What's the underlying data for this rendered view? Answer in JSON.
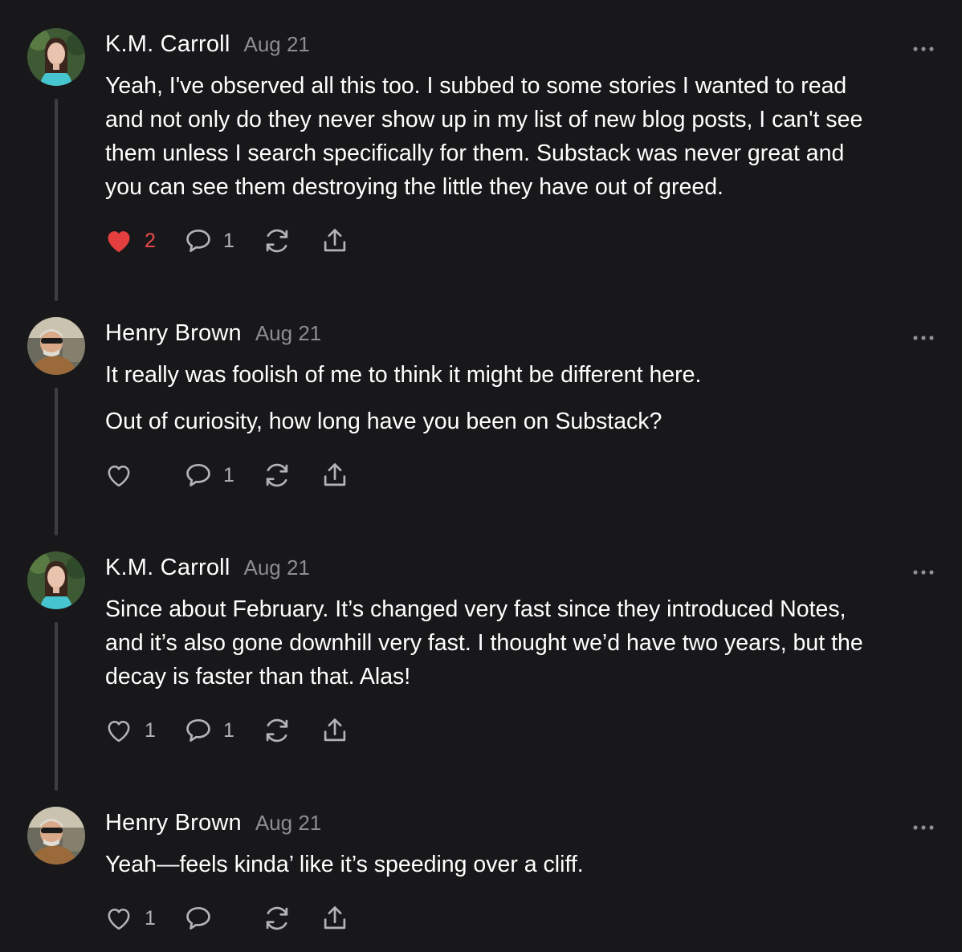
{
  "accent": "#e53e3e",
  "comments": [
    {
      "author": "K.M. Carroll",
      "date": "Aug 21",
      "avatar": "woman-portrait",
      "paragraphs": [
        "Yeah, I've observed all this too. I subbed to some stories I wanted to read\nand not only do they never show up in my list of new blog posts, I can't see\nthem unless I search specifically for them. Substack was never great and\nyou can see them destroying the little they have out of greed."
      ],
      "likes": "2",
      "liked": true,
      "replies": "1"
    },
    {
      "author": "Henry Brown",
      "date": "Aug 21",
      "avatar": "man-sunglasses-portrait",
      "paragraphs": [
        "It really was foolish of me to think it might be different here.",
        "Out of curiosity, how long have you been on Substack?"
      ],
      "likes": "",
      "liked": false,
      "replies": "1"
    },
    {
      "author": "K.M. Carroll",
      "date": "Aug 21",
      "avatar": "woman-portrait",
      "paragraphs": [
        "Since about February. It’s changed very fast since they introduced Notes,\nand it’s also gone downhill very fast. I thought we’d have two years, but the\ndecay is faster than that. Alas!"
      ],
      "likes": "1",
      "liked": false,
      "replies": "1"
    },
    {
      "author": "Henry Brown",
      "date": "Aug 21",
      "avatar": "man-sunglasses-portrait",
      "paragraphs": [
        "Yeah—feels kinda’ like it’s speeding over a cliff."
      ],
      "likes": "1",
      "liked": false,
      "replies": ""
    }
  ],
  "icons": {
    "like": "heart-icon",
    "reply": "comment-bubble-icon",
    "restack": "restack-icon",
    "share": "share-icon",
    "more": "more-options-icon"
  }
}
